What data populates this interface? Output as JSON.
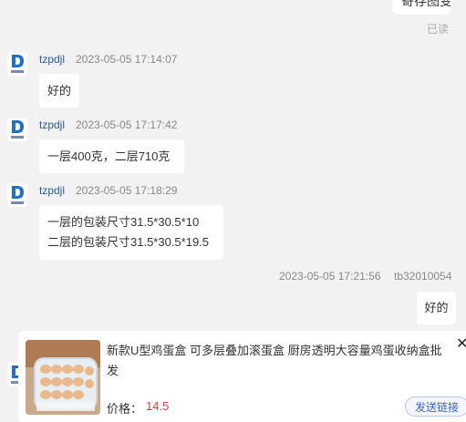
{
  "top_bubble_text": "寄存图变",
  "read_status": "已读",
  "colors": {
    "sender": "#2a5aa8",
    "price": "#e4393c",
    "avatar_blue": "#1e6fd0",
    "background": "#f2f2f2"
  },
  "messages": [
    {
      "sender": "tzpdjl",
      "time": "2023-05-05 17:14:07",
      "lines": [
        "好的"
      ],
      "avatar_icon": "shop-logo-icon"
    },
    {
      "sender": "tzpdjl",
      "time": "2023-05-05 17:17:42",
      "lines": [
        "一层400克，二层710克"
      ],
      "avatar_icon": "shop-logo-icon"
    },
    {
      "sender": "tzpdjl",
      "time": "2023-05-05 17:18:29",
      "lines": [
        "一层的包装尺寸31.5*30.5*10",
        "二层的包装尺寸31.5*30.5*19.5"
      ],
      "avatar_icon": "shop-logo-icon"
    }
  ],
  "outgoing": {
    "time": "2023-05-05 17:21:56",
    "sender": "tb32010054",
    "text": "好的"
  },
  "product_card": {
    "title": "新款U型鸡蛋盒 可多层叠加滚蛋盒 厨房透明大容量鸡蛋收纳盒批发",
    "price_label": "价格：",
    "price": "14.5",
    "send_link_label": "发送链接",
    "close_icon": "close-icon"
  }
}
